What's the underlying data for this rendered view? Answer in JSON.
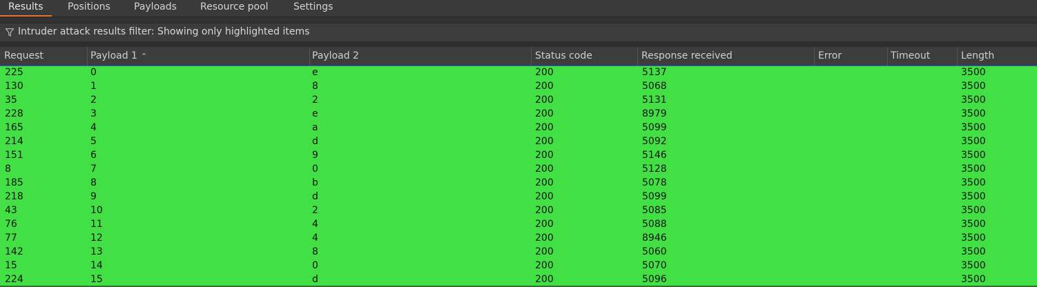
{
  "tabs": [
    {
      "label": "Results",
      "active": true
    },
    {
      "label": "Positions"
    },
    {
      "label": "Payloads"
    },
    {
      "label": "Resource pool"
    },
    {
      "label": "Settings"
    }
  ],
  "filter": {
    "icon": "filter-icon",
    "text": "Intruder attack results filter: Showing only highlighted items"
  },
  "table": {
    "highlight_color": "#42e044",
    "sorted_column": "Payload 1",
    "sort_direction": "ascending",
    "columns": [
      "Request",
      "Payload 1",
      "Payload 2",
      "Status code",
      "Response received",
      "Error",
      "Timeout",
      "Length"
    ],
    "rows": [
      [
        "225",
        "0",
        "e",
        "200",
        "5137",
        "",
        "",
        "3500"
      ],
      [
        "130",
        "1",
        "8",
        "200",
        "5068",
        "",
        "",
        "3500"
      ],
      [
        "35",
        "2",
        "2",
        "200",
        "5131",
        "",
        "",
        "3500"
      ],
      [
        "228",
        "3",
        "e",
        "200",
        "8979",
        "",
        "",
        "3500"
      ],
      [
        "165",
        "4",
        "a",
        "200",
        "5099",
        "",
        "",
        "3500"
      ],
      [
        "214",
        "5",
        "d",
        "200",
        "5092",
        "",
        "",
        "3500"
      ],
      [
        "151",
        "6",
        "9",
        "200",
        "5146",
        "",
        "",
        "3500"
      ],
      [
        "8",
        "7",
        "0",
        "200",
        "5128",
        "",
        "",
        "3500"
      ],
      [
        "185",
        "8",
        "b",
        "200",
        "5078",
        "",
        "",
        "3500"
      ],
      [
        "218",
        "9",
        "d",
        "200",
        "5099",
        "",
        "",
        "3500"
      ],
      [
        "43",
        "10",
        "2",
        "200",
        "5085",
        "",
        "",
        "3500"
      ],
      [
        "76",
        "11",
        "4",
        "200",
        "5088",
        "",
        "",
        "3500"
      ],
      [
        "77",
        "12",
        "4",
        "200",
        "8946",
        "",
        "",
        "3500"
      ],
      [
        "142",
        "13",
        "8",
        "200",
        "5060",
        "",
        "",
        "3500"
      ],
      [
        "15",
        "14",
        "0",
        "200",
        "5070",
        "",
        "",
        "3500"
      ],
      [
        "224",
        "15",
        "d",
        "200",
        "5096",
        "",
        "",
        "3500"
      ]
    ]
  }
}
